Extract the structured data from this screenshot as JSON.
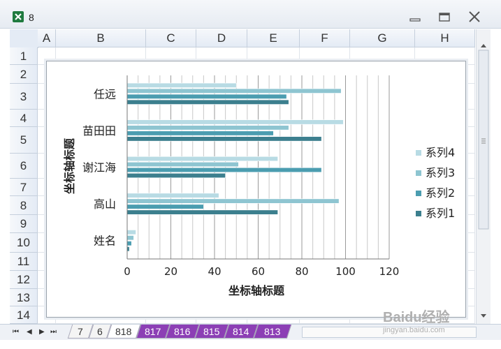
{
  "window": {
    "title": "8"
  },
  "columns": [
    "A",
    "B",
    "C",
    "D",
    "E",
    "F",
    "G",
    "H"
  ],
  "rows": [
    "1",
    "2",
    "3",
    "4",
    "5",
    "6",
    "7",
    "8",
    "9",
    "10",
    "11",
    "12",
    "13",
    "14"
  ],
  "chart_data": {
    "type": "bar",
    "orientation": "horizontal",
    "categories": [
      "任远",
      "苗田田",
      "谢江海",
      "高山",
      "姓名"
    ],
    "series": [
      {
        "name": "系列1",
        "color": "#3c7f8e",
        "values": [
          74,
          89,
          45,
          69,
          1
        ]
      },
      {
        "name": "系列2",
        "color": "#4b9db0",
        "values": [
          73,
          67,
          89,
          35,
          2
        ]
      },
      {
        "name": "系列3",
        "color": "#8ec5d1",
        "values": [
          98,
          74,
          51,
          97,
          3
        ]
      },
      {
        "name": "系列4",
        "color": "#b8dbe4",
        "values": [
          50,
          99,
          69,
          42,
          4
        ]
      }
    ],
    "xlim": [
      0,
      120
    ],
    "xticks": [
      "0",
      "20",
      "40",
      "60",
      "80",
      "100",
      "120"
    ],
    "xlabel": "坐标轴标题",
    "ylabel": "坐标轴标题",
    "legend_position": "right",
    "grid": true
  },
  "sheets": {
    "tabs": [
      {
        "label": "7",
        "style": "plain"
      },
      {
        "label": "6",
        "style": "plain"
      },
      {
        "label": "818",
        "style": "active"
      },
      {
        "label": "817",
        "style": "purple"
      },
      {
        "label": "816",
        "style": "purple"
      },
      {
        "label": "815",
        "style": "purple"
      },
      {
        "label": "814",
        "style": "purple"
      },
      {
        "label": "813",
        "style": "purple"
      }
    ]
  },
  "watermark": {
    "text": "Baidu经验",
    "subtext": "jingyan.baidu.com"
  }
}
